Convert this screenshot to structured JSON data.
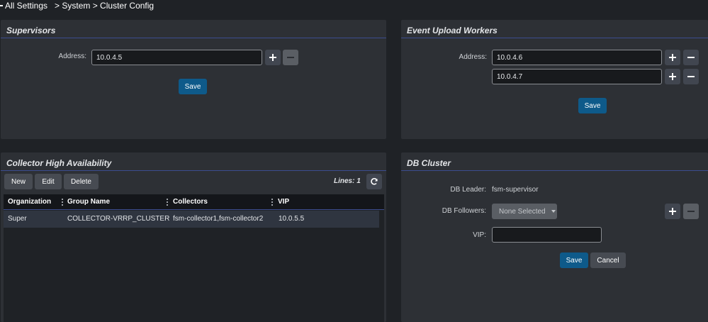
{
  "breadcrumb": {
    "root": "All Settings",
    "path": "> System > Cluster Config"
  },
  "supervisors": {
    "title": "Supervisors",
    "address_label": "Address:",
    "addresses": [
      "10.0.4.5"
    ],
    "save_label": "Save"
  },
  "workers": {
    "title": "Event Upload Workers",
    "address_label": "Address:",
    "addresses": [
      "10.0.4.6",
      "10.0.4.7"
    ],
    "save_label": "Save"
  },
  "collector_ha": {
    "title": "Collector High Availability",
    "buttons": {
      "new": "New",
      "edit": "Edit",
      "delete": "Delete"
    },
    "lines_label": "Lines: 1",
    "columns": [
      "Organization",
      "Group Name",
      "Collectors",
      "VIP"
    ],
    "rows": [
      {
        "organization": "Super",
        "group_name": "COLLECTOR-VRRP_CLUSTER",
        "collectors": "fsm-collector1,fsm-collector2",
        "vip": "10.0.5.5"
      }
    ]
  },
  "db_cluster": {
    "title": "DB Cluster",
    "leader_label": "DB Leader:",
    "leader_value": "fsm-supervisor",
    "followers_label": "DB Followers:",
    "followers_value": "None Selected",
    "vip_label": "VIP:",
    "vip_value": "",
    "save_label": "Save",
    "cancel_label": "Cancel"
  },
  "icons": {
    "add": "plus-icon",
    "remove": "minus-icon",
    "refresh": "refresh-icon",
    "dropdown": "chevron-down-icon"
  },
  "colors": {
    "primary_button": "#0e5a8a",
    "header_rule": "#3c4d8f",
    "panel_bg": "#2d3035",
    "page_bg": "#1f2226"
  }
}
